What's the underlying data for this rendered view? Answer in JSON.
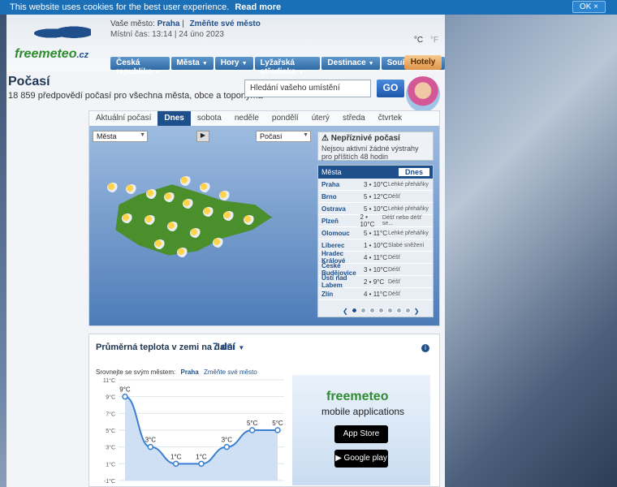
{
  "cookie": {
    "text": "This website uses cookies for the best user experience.",
    "link": "Read more",
    "ok": "OK ×"
  },
  "header": {
    "logo_text": "freemeteo",
    "logo_domain": ".cz",
    "city_label": "Vaše město:",
    "city": "Praha",
    "change_city": "Změňte své město",
    "time": "Místní čas: 13:14 | 24 úno 2023",
    "units": {
      "c": "°C",
      "f": "°F"
    },
    "nav": [
      "Česká republika",
      "Města",
      "Hory",
      "Lyžařská střediska",
      "Destinace",
      "Souřadnice"
    ],
    "hotels": "Hotely"
  },
  "main": {
    "title": "Počasí",
    "subtitle": "18 859 předpovědí počasí pro všechna města, obce a toponyma",
    "search_placeholder": "Hledání vašeho umístění",
    "go": "GO"
  },
  "tabs": [
    "Aktuální počasí",
    "Dnes",
    "sobota",
    "neděle",
    "pondělí",
    "úterý",
    "středa",
    "čtvrtek"
  ],
  "map": {
    "select_left": "Města",
    "select_right": "Počasí",
    "warning_title": "Nepříznivé počasí",
    "warning_text": "Nejsou aktivní žádné výstrahy pro příštích 48 hodin",
    "cities_label": "Města",
    "day_label": "Dnes",
    "cities": [
      {
        "name": "Praha",
        "temp": "3 • 10°C",
        "desc": "Lehké přeháňky"
      },
      {
        "name": "Brno",
        "temp": "5 • 12°C",
        "desc": "Déšť"
      },
      {
        "name": "Ostrava",
        "temp": "5 • 10°C",
        "desc": "Lehké přeháňky"
      },
      {
        "name": "Plzeň",
        "temp": "2 • 10°C",
        "desc": "Déšť nebo déšť se..."
      },
      {
        "name": "Olomouc",
        "temp": "5 • 11°C",
        "desc": "Lehké přeháňky"
      },
      {
        "name": "Liberec",
        "temp": "1 • 10°C",
        "desc": "Slabé sněžení"
      },
      {
        "name": "Hradec Králové",
        "temp": "4 • 11°C",
        "desc": "Déšť"
      },
      {
        "name": "České Budějovice",
        "temp": "3 • 10°C",
        "desc": "Déšť"
      },
      {
        "name": "Ústí nad Labem",
        "temp": "2 • 9°C",
        "desc": "Déšť"
      },
      {
        "name": "Zlín",
        "temp": "4 • 11°C",
        "desc": "Déšť"
      }
    ]
  },
  "avg": {
    "title": "Průměrná teplota v zemi na další",
    "days": "7 dní",
    "compare_label": "Srovnejte se svým městem:",
    "compare_city": "Praha",
    "compare_change": "Změňte své město"
  },
  "chart_data": {
    "type": "line",
    "y_ticks": [
      "11°C",
      "9°C",
      "7°C",
      "5°C",
      "3°C",
      "1°C",
      "-1°C"
    ],
    "ylim": [
      -1,
      11
    ],
    "values": [
      9,
      3,
      1,
      1,
      3,
      5,
      5
    ],
    "point_labels": [
      "9°C",
      "3°C",
      "1°C",
      "1°C",
      "3°C",
      "5°C",
      "5°C"
    ]
  },
  "mobile": {
    "brand": "freemeteo",
    "apps": "mobile applications",
    "appstore": "App Store",
    "googleplay": "Google play"
  }
}
